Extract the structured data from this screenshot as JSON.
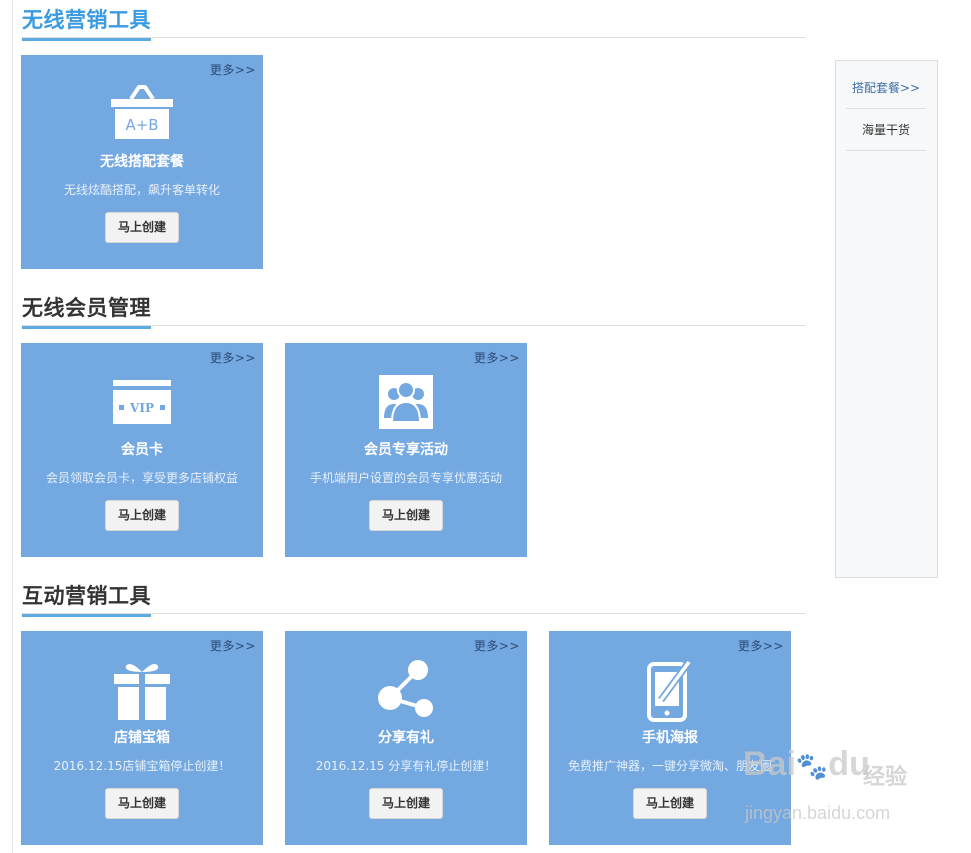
{
  "sections": [
    {
      "title": "无线营销工具",
      "cards": [
        {
          "more": "更多>>",
          "icon": "package-ab-icon",
          "icon_text": "A+B",
          "title": "无线搭配套餐",
          "desc": "无线炫酷搭配，飙升客单转化",
          "button": "马上创建"
        }
      ]
    },
    {
      "title": "无线会员管理",
      "cards": [
        {
          "more": "更多>>",
          "icon": "vip-card-icon",
          "icon_text": "VIP",
          "title": "会员卡",
          "desc": "会员领取会员卡，享受更多店铺权益",
          "button": "马上创建"
        },
        {
          "more": "更多>>",
          "icon": "member-group-icon",
          "title": "会员专享活动",
          "desc": "手机端用户设置的会员专享优惠活动",
          "button": "马上创建"
        }
      ]
    },
    {
      "title": "互动营销工具",
      "cards": [
        {
          "more": "更多>>",
          "icon": "gift-box-icon",
          "title": "店铺宝箱",
          "desc": "2016.12.15店铺宝箱停止创建！",
          "button": "马上创建"
        },
        {
          "more": "更多>>",
          "icon": "share-icon",
          "title": "分享有礼",
          "desc": "2016.12.15 分享有礼停止创建！",
          "button": "马上创建"
        },
        {
          "more": "更多>>",
          "icon": "phone-brush-icon",
          "title": "手机海报",
          "desc": "免费推广神器，一键分享微淘、朋友圈",
          "button": "马上创建"
        }
      ]
    }
  ],
  "sidebar": {
    "items": [
      "搭配套餐>>",
      "海量干货"
    ]
  },
  "watermark": {
    "brand": "Bai",
    "brand_tail": "du",
    "cn": "经验",
    "url": "jingyan.baidu.com"
  },
  "colors": {
    "card_bg": "#74a8e0",
    "title_accent": "#5da9e2",
    "first_title": "#3a9be0",
    "more_link": "#2b4a72"
  }
}
